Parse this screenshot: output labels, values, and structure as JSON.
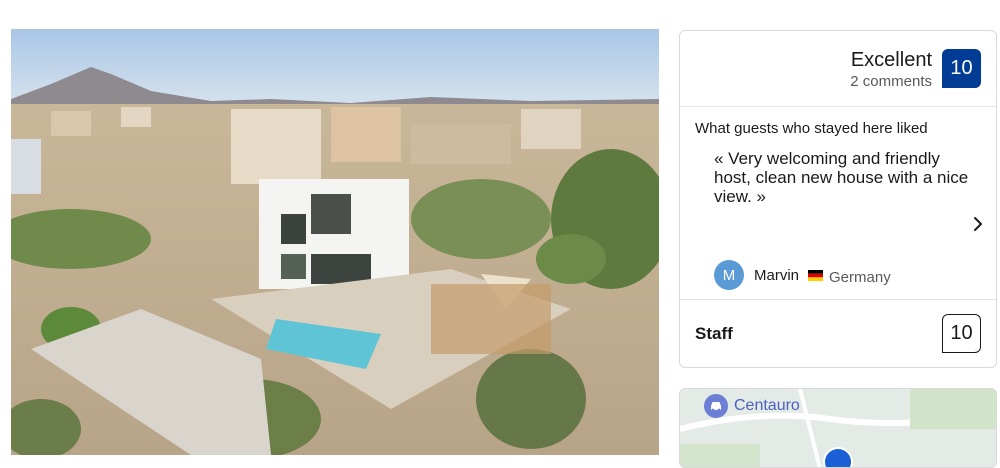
{
  "photo": {
    "alt_icon": "property-photo"
  },
  "review": {
    "score_word": "Excellent",
    "comment_count": "2 comments",
    "score": "10",
    "liked_title": "What guests who stayed here liked",
    "quote": "« Very welcoming and friendly host, clean new house with a nice view. »",
    "reviewer": {
      "initial": "M",
      "name": "Marvin",
      "country": "Germany",
      "flag_icon": "germany-flag-icon"
    },
    "next_icon": "chevron-right-icon",
    "category": {
      "label": "Staff",
      "score": "10"
    }
  },
  "map": {
    "poi_label": "Centauro",
    "poi_icon": "car-rental-icon"
  },
  "colors": {
    "score_badge": "#003b95",
    "avatar": "#5b9bd5",
    "map_poi": "#6d7fd4",
    "map_pin": "#1a5fd6"
  }
}
